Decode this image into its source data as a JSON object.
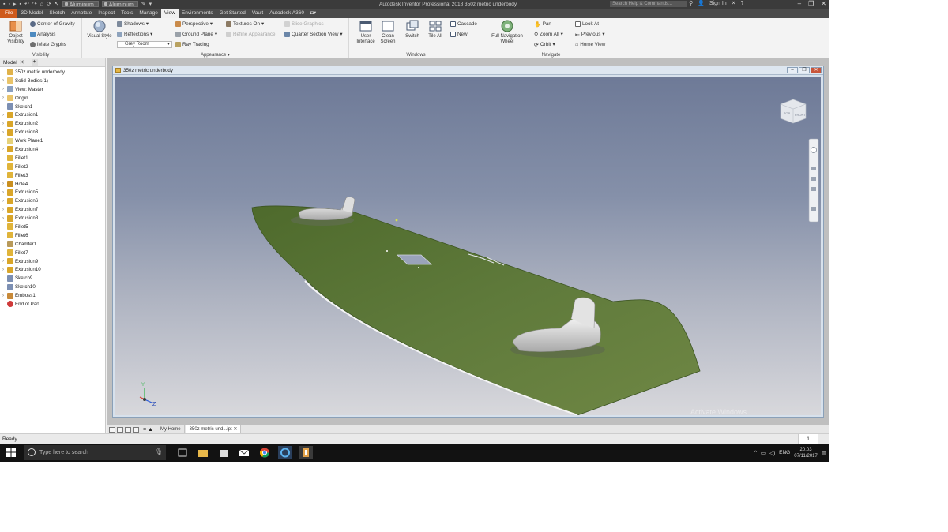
{
  "titlebar": {
    "material_combo": "Aluminum 6061",
    "appearance_combo": "Aluminum",
    "app_title": "Autodesk Inventor Professional 2018   350z metric underbody",
    "search_placeholder": "Search Help & Commands...",
    "sign_in": "Sign In"
  },
  "ribbon_tabs": [
    {
      "label": "File"
    },
    {
      "label": "3D Model"
    },
    {
      "label": "Sketch"
    },
    {
      "label": "Annotate"
    },
    {
      "label": "Inspect"
    },
    {
      "label": "Tools"
    },
    {
      "label": "Manage"
    },
    {
      "label": "View"
    },
    {
      "label": "Environments"
    },
    {
      "label": "Get Started"
    },
    {
      "label": "Vault"
    },
    {
      "label": "Autodesk A360"
    }
  ],
  "ribbon": {
    "visibility": {
      "object_visibility": "Object Visibility",
      "center_of_gravity": "Center of Gravity",
      "analysis": "Analysis",
      "imate_glyphs": "iMate Glyphs",
      "label": "Visibility"
    },
    "appearance": {
      "visual_style": "Visual Style",
      "shadows": "Shadows",
      "reflections": "Reflections",
      "lighting": "Grey Room",
      "perspective": "Perspective",
      "ground_plane": "Ground Plane",
      "ray_tracing": "Ray Tracing",
      "textures_on": "Textures On",
      "refine_appearance": "Refine Appearance",
      "slice_graphics": "Slice Graphics",
      "quarter_section_view": "Quarter Section View",
      "label": "Appearance"
    },
    "windows": {
      "user_interface": "User Interface",
      "clean_screen": "Clean Screen",
      "switch": "Switch",
      "tile_all": "Tile All",
      "cascade": "Cascade",
      "new": "New",
      "label": "Windows"
    },
    "navigate": {
      "full_navigation_wheel": "Full Navigation Wheel",
      "pan": "Pan",
      "zoom_all": "Zoom All",
      "orbit": "Orbit",
      "look_at": "Look At",
      "previous": "Previous",
      "home_view": "Home View",
      "label": "Navigate"
    }
  },
  "browser": {
    "tab_label": "Model",
    "items": [
      {
        "label": "350z metric underbody",
        "icon": "part-icon",
        "expandable": false
      },
      {
        "label": "Solid Bodies(1)",
        "icon": "folder-icon",
        "expandable": true
      },
      {
        "label": "View: Master",
        "icon": "view-icon",
        "expandable": true
      },
      {
        "label": "Origin",
        "icon": "folder-icon",
        "expandable": true
      },
      {
        "label": "Sketch1",
        "icon": "sketch-icon",
        "expandable": false
      },
      {
        "label": "Extrusion1",
        "icon": "extrusion-icon",
        "expandable": true
      },
      {
        "label": "Extrusion2",
        "icon": "extrusion-icon",
        "expandable": true
      },
      {
        "label": "Extrusion3",
        "icon": "extrusion-icon",
        "expandable": true
      },
      {
        "label": "Work Plane1",
        "icon": "workplane-icon",
        "expandable": false
      },
      {
        "label": "Extrusion4",
        "icon": "extrusion-icon",
        "expandable": true
      },
      {
        "label": "Fillet1",
        "icon": "fillet-icon",
        "expandable": false
      },
      {
        "label": "Fillet2",
        "icon": "fillet-icon",
        "expandable": false
      },
      {
        "label": "Fillet3",
        "icon": "fillet-icon",
        "expandable": false
      },
      {
        "label": "Hole4",
        "icon": "hole-icon",
        "expandable": true
      },
      {
        "label": "Extrusion5",
        "icon": "extrusion-icon",
        "expandable": true
      },
      {
        "label": "Extrusion6",
        "icon": "extrusion-icon",
        "expandable": true
      },
      {
        "label": "Extrusion7",
        "icon": "extrusion-icon",
        "expandable": true
      },
      {
        "label": "Extrusion8",
        "icon": "extrusion-icon",
        "expandable": true
      },
      {
        "label": "Fillet5",
        "icon": "fillet-icon",
        "expandable": false
      },
      {
        "label": "Fillet6",
        "icon": "fillet-icon",
        "expandable": false
      },
      {
        "label": "Chamfer1",
        "icon": "chamfer-icon",
        "expandable": false
      },
      {
        "label": "Fillet7",
        "icon": "fillet-icon",
        "expandable": false
      },
      {
        "label": "Extrusion9",
        "icon": "extrusion-icon",
        "expandable": true
      },
      {
        "label": "Extrusion10",
        "icon": "extrusion-icon",
        "expandable": true
      },
      {
        "label": "Sketch9",
        "icon": "sketch-icon",
        "expandable": false
      },
      {
        "label": "Sketch10",
        "icon": "sketch-icon",
        "expandable": false
      },
      {
        "label": "Emboss1",
        "icon": "emboss-icon",
        "expandable": true
      },
      {
        "label": "End of Part",
        "icon": "end-of-part-icon",
        "expandable": false
      }
    ]
  },
  "document": {
    "window_title": "350z metric underbody",
    "viewcube_faces": [
      "TOP",
      "FRONT"
    ],
    "watermark": "Activate Windows"
  },
  "doc_tabs": {
    "home": "My Home",
    "active": "350z metric und...ipt"
  },
  "status": {
    "text": "Ready",
    "page": "1"
  },
  "taskbar": {
    "search_placeholder": "Type here to search",
    "language": "ENG",
    "time": "20:03",
    "date": "07/11/2017"
  },
  "colors": {
    "ribbon_file_tab": "#ce5a1c",
    "plate_green": "#5f7a3b",
    "viewport_top": "#6e7a97",
    "viewport_bottom": "#d8d8dc"
  }
}
